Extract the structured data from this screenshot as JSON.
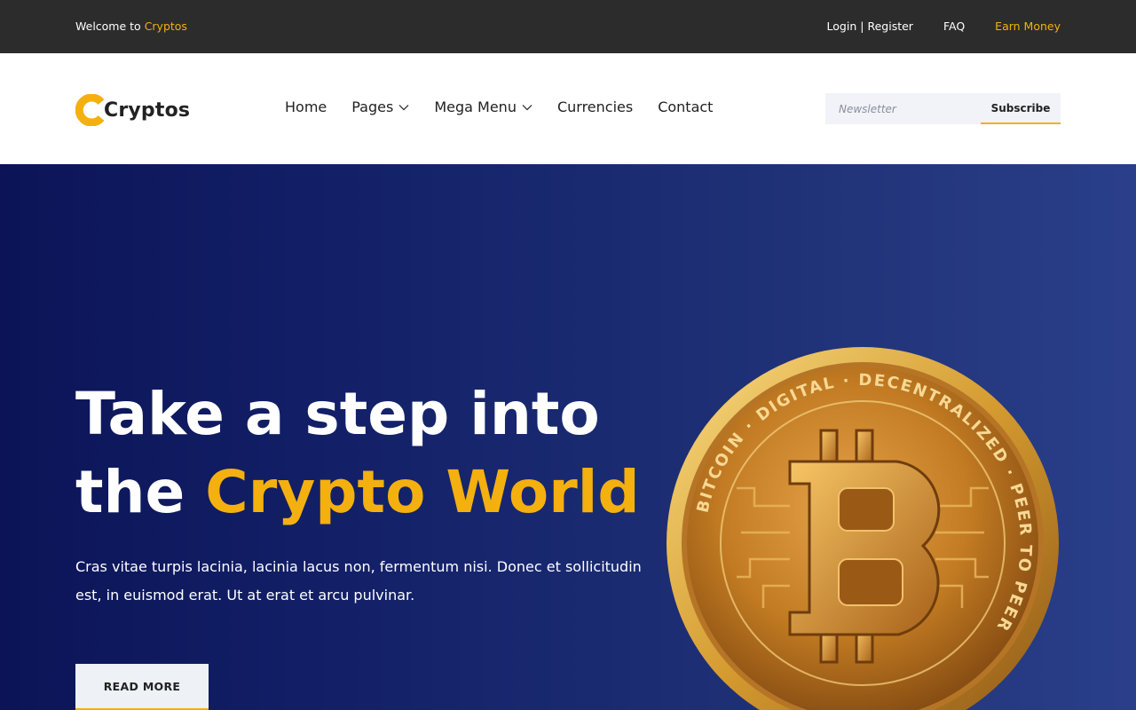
{
  "topbar": {
    "welcome_prefix": "Welcome to",
    "welcome_brand": "Cryptos",
    "login": "Login",
    "separator": "|",
    "register": "Register",
    "faq": "FAQ",
    "earn": "Earn Money"
  },
  "header": {
    "logo_text": "Cryptos",
    "nav": {
      "home": "Home",
      "pages": "Pages",
      "mega_menu": "Mega Menu",
      "currencies": "Currencies",
      "contact": "Contact"
    },
    "newsletter": {
      "placeholder": "Newsletter",
      "button": "Subscribe"
    }
  },
  "hero": {
    "title_line1": "Take a step into",
    "title_line2_plain": "the",
    "title_line2_accent": "Crypto World",
    "text": "Cras vitae turpis lacinia, lacinia lacus non, fermentum nisi. Donec et sollicitudin est, in euismod erat. Ut at erat et arcu pulvinar.",
    "button": "READ MORE",
    "coin_ring_text": "BITCOIN · DIGITAL · DECENTRALIZED · PEER TO PEER"
  },
  "colors": {
    "accent": "#f4b00f",
    "topbar_bg": "#2c2c2c",
    "hero_start": "#0c1457",
    "hero_end": "#2a3f8a"
  },
  "icons": {
    "logo": "c-logo-icon",
    "dropdown": "chevron-down-icon",
    "coin": "bitcoin-coin-icon"
  }
}
